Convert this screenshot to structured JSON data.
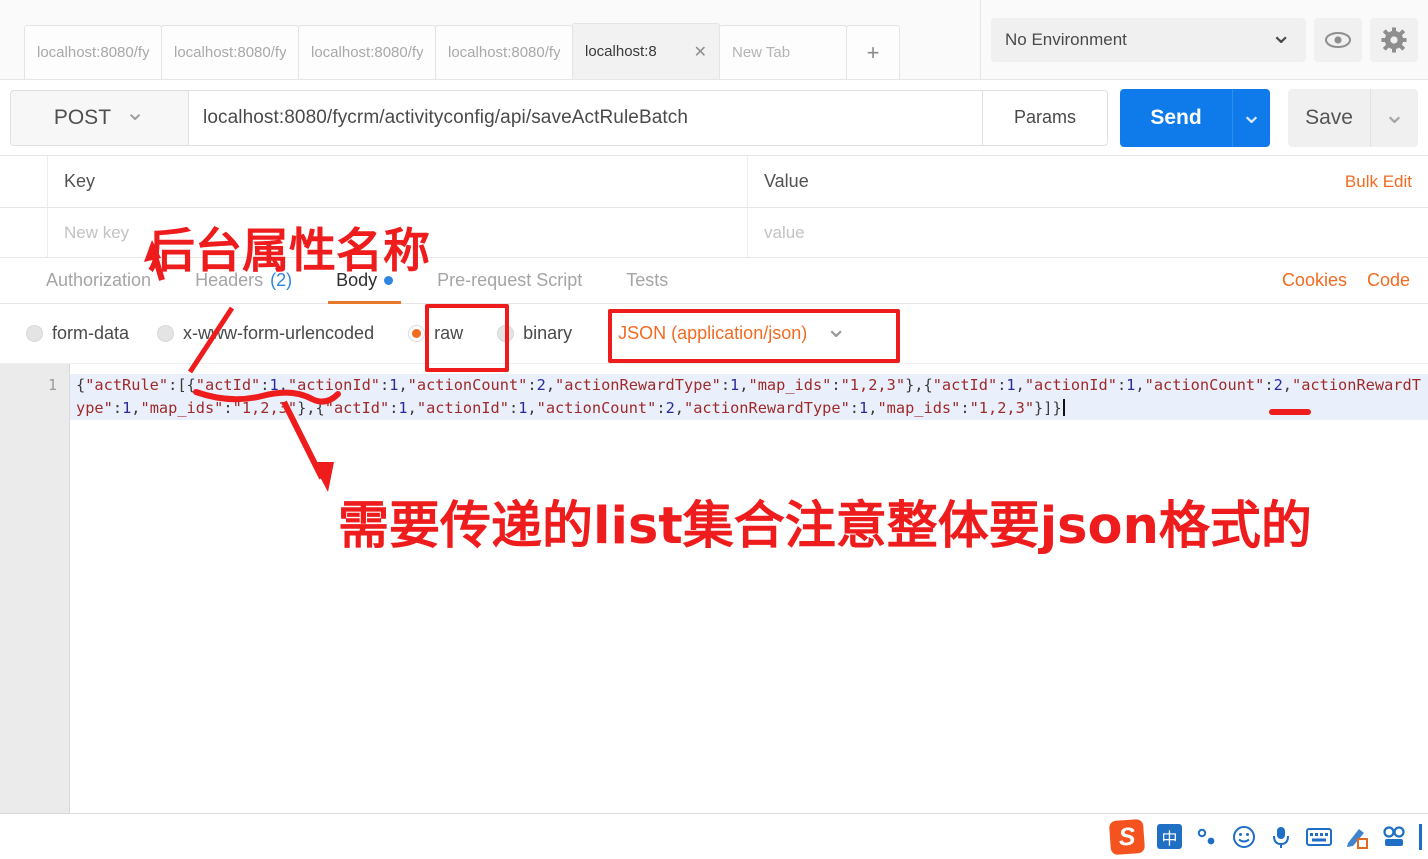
{
  "browser": {
    "tabs": [
      {
        "label": "localhost:8080/fy",
        "active": false
      },
      {
        "label": "localhost:8080/fy",
        "active": false
      },
      {
        "label": "localhost:8080/fy",
        "active": false
      },
      {
        "label": "localhost:8080/fy",
        "active": false
      },
      {
        "label": "localhost:8",
        "active": true
      },
      {
        "label": "New Tab",
        "active": false
      }
    ],
    "new_tab_plus": "+",
    "close_glyph": "✕"
  },
  "environment": {
    "selected": "No Environment",
    "chevron": "⌄",
    "eye_icon": "eye-icon",
    "gear_icon": "gear-icon"
  },
  "request": {
    "method": "POST",
    "method_chevron": "⌄",
    "url": "localhost:8080/fycrm/activityconfig/api/saveActRuleBatch",
    "params_label": "Params",
    "send_label": "Send",
    "send_chevron": "⌄",
    "save_label": "Save",
    "save_chevron": "⌄"
  },
  "params_table": {
    "header_key": "Key",
    "header_value": "Value",
    "bulk_edit": "Bulk Edit",
    "new_key_placeholder": "New key",
    "value_placeholder": "value"
  },
  "request_tabs": {
    "items": [
      {
        "label": "Authorization",
        "active": false,
        "count": null,
        "dot": false
      },
      {
        "label": "Headers",
        "active": false,
        "count": "(2)",
        "dot": false
      },
      {
        "label": "Body",
        "active": true,
        "count": null,
        "dot": true
      },
      {
        "label": "Pre-request Script",
        "active": false,
        "count": null,
        "dot": false
      },
      {
        "label": "Tests",
        "active": false,
        "count": null,
        "dot": false
      }
    ],
    "cookies_label": "Cookies",
    "code_label": "Code"
  },
  "body_type": {
    "options": [
      {
        "label": "form-data",
        "selected": false
      },
      {
        "label": "x-www-form-urlencoded",
        "selected": false
      },
      {
        "label": "raw",
        "selected": true
      },
      {
        "label": "binary",
        "selected": false
      }
    ],
    "content_type": "JSON (application/json)",
    "content_type_chevron": "⌄"
  },
  "editor": {
    "line_number": "1",
    "body_raw": "{\"actRule\":[{\"actId\":1,\"actionId\":1,\"actionCount\":2,\"actionRewardType\":1,\"map_ids\":\"1,2,3\"},{\"actId\":1,\"actionId\":1,\"actionCount\":2,\"actionRewardType\":1,\"map_ids\":\"1,2,3\"},{\"actId\":1,\"actionId\":1,\"actionCount\":2,\"actionRewardType\":1,\"map_ids\":\"1,2,3\"}]}"
  },
  "annotations": {
    "top_note": "后台属性名称",
    "bottom_note": "需要传递的list集合注意整体要json格式的"
  },
  "ime": {
    "logo": "S",
    "mode_label": "中",
    "punct_icon": "punctuation-icon",
    "emoji_icon": "☺",
    "mic_icon": "microphone-icon",
    "keyboard_icon": "keyboard-icon",
    "handwriting_icon": "handwriting-icon",
    "toolbox_icon": "toolbox-icon"
  },
  "colors": {
    "accent_orange": "#f26b21",
    "send_blue": "#0f7beb",
    "annotation_red": "#ee1c1c",
    "tab_underline": "#e8792b"
  }
}
